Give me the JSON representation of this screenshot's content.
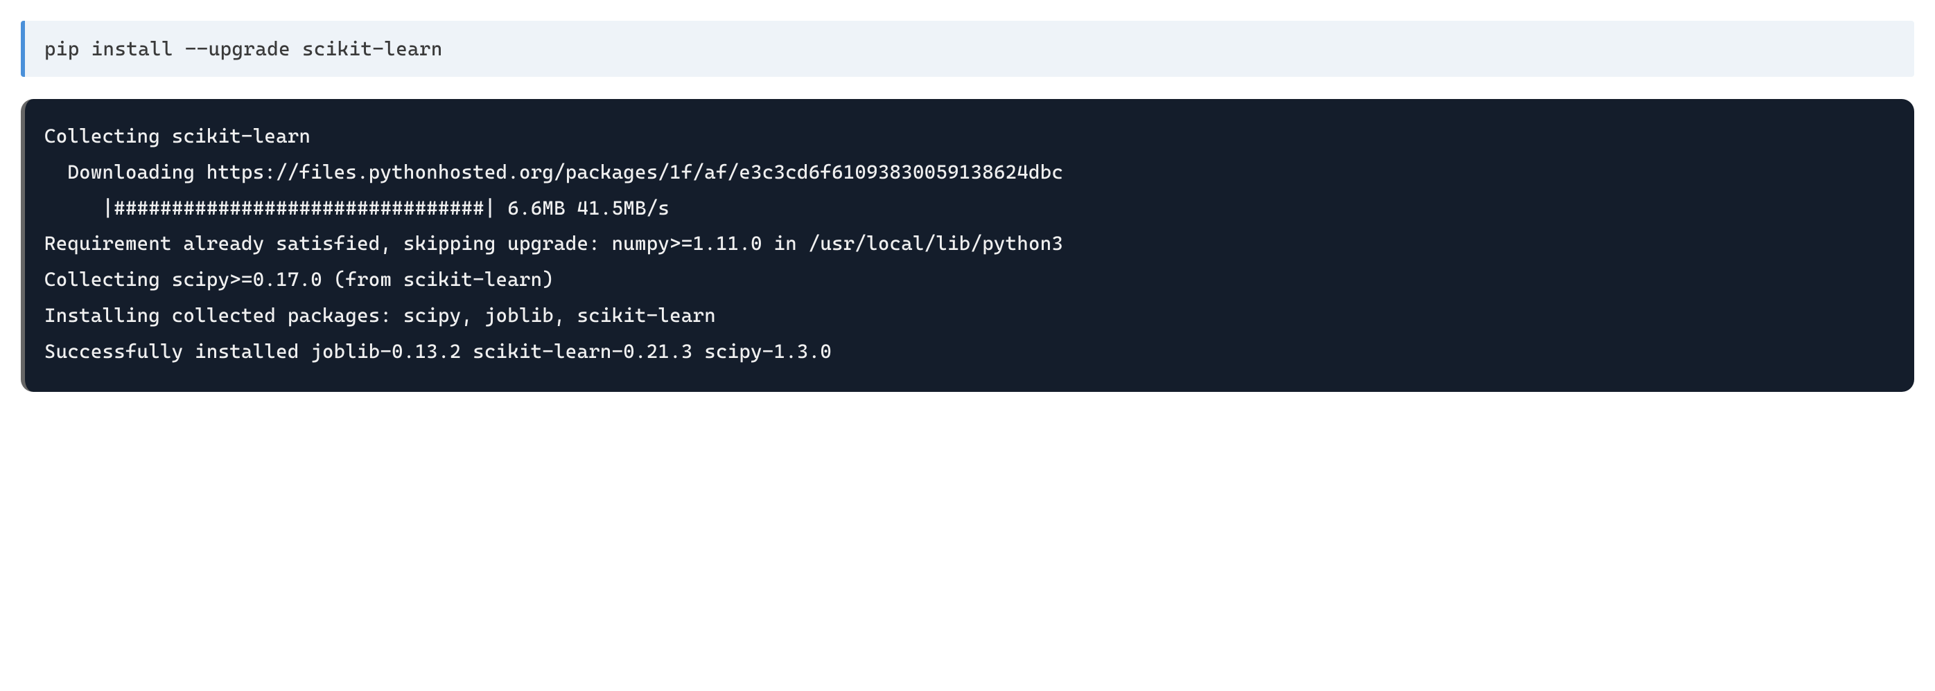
{
  "input": {
    "command": "pip install --upgrade scikit-learn"
  },
  "output": {
    "lines": [
      "Collecting scikit-learn",
      "  Downloading https://files.pythonhosted.org/packages/1f/af/e3c3cd6f61093830059138624dbc",
      "     |################################| 6.6MB 41.5MB/s ",
      "Requirement already satisfied, skipping upgrade: numpy>=1.11.0 in /usr/local/lib/python3",
      "Collecting scipy>=0.17.0 (from scikit-learn)",
      "Installing collected packages: scipy, joblib, scikit-learn",
      "Successfully installed joblib-0.13.2 scikit-learn-0.21.3 scipy-1.3.0"
    ]
  }
}
